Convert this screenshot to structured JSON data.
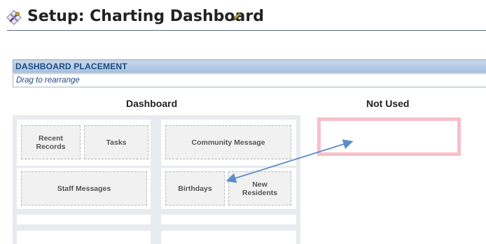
{
  "header": {
    "title": "Setup: Charting Dashboard",
    "title_icon": "wrench-screwdriver-icon",
    "edit_icon": "pencil-icon"
  },
  "panel": {
    "title": "DASHBOARD PLACEMENT",
    "instructions": "Drag to rearrange"
  },
  "columns": {
    "dashboard_heading": "Dashboard",
    "not_used_heading": "Not Used"
  },
  "widgets": {
    "recent_records": "Recent\nRecords",
    "tasks": "Tasks",
    "community_message": "Community Message",
    "staff_messages": "Staff Messages",
    "birthdays": "Birthdays",
    "new_residents": "New\nResidents"
  },
  "colors": {
    "panel_header": "#b4cbe5",
    "panel_title_text": "#1e4a80",
    "dashboard_bg": "#e7eaef",
    "not_used_border": "#f6bfca",
    "annotation_arrow": "#5b8cc8"
  }
}
